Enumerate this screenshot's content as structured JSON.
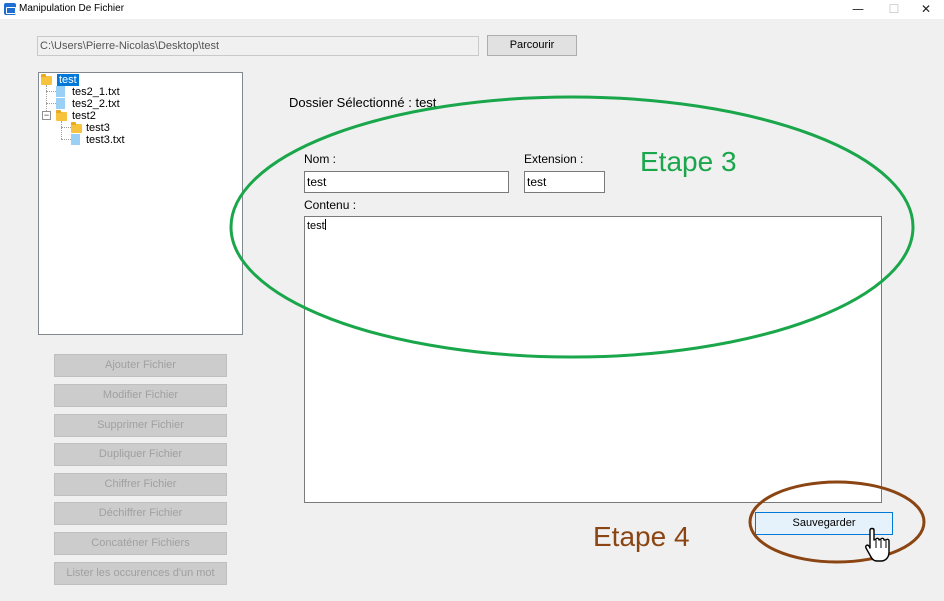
{
  "window": {
    "title": "Manipulation De Fichier",
    "controls": {
      "minimize": "—",
      "maximize": "☐",
      "close": "✕"
    }
  },
  "path_bar": {
    "value": "C:\\Users\\Pierre-Nicolas\\Desktop\\test",
    "browse_label": "Parcourir"
  },
  "tree": {
    "root": "test",
    "items": [
      {
        "label": "tes2_1.txt",
        "type": "file"
      },
      {
        "label": "tes2_2.txt",
        "type": "file"
      },
      {
        "label": "test2",
        "type": "folder",
        "expanded": true
      },
      {
        "label": "test3",
        "type": "folder"
      },
      {
        "label": "test3.txt",
        "type": "file"
      }
    ]
  },
  "actions": [
    "Ajouter Fichier",
    "Modifier Fichier",
    "Supprimer Fichier",
    "Dupliquer Fichier",
    "Chiffrer Fichier",
    "Déchiffrer Fichier",
    "Concaténer Fichiers",
    "Lister les occurences d'un mot"
  ],
  "editor": {
    "selected_folder_label": "Dossier Sélectionné : test",
    "name_label": "Nom :",
    "name_value": "test",
    "extension_label": "Extension :",
    "extension_value": "test",
    "content_label": "Contenu :",
    "content_value": "test",
    "save_label": "Sauvegarder"
  },
  "annotations": {
    "step3": {
      "text": "Etape 3",
      "color": "#1aa64a"
    },
    "step4": {
      "text": "Etape 4",
      "color": "#8b4513"
    }
  },
  "colors": {
    "accent": "#0078d7",
    "folder": "#f7c23c",
    "file": "#9bd0f6"
  }
}
